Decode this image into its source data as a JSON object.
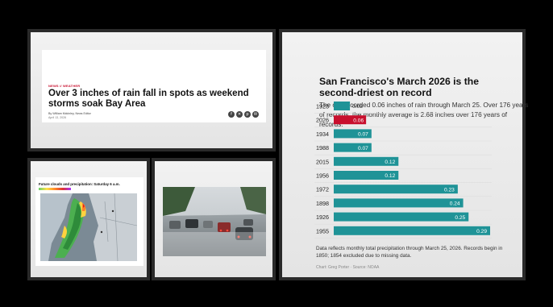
{
  "article": {
    "kicker": "NEWS // WEATHER",
    "headline": "Over 3 inches of rain fall in spots as weekend storms soak Bay Area",
    "byline": "By William Mckinley, News Editor",
    "date": "April 13, 2026",
    "share_icons": [
      "facebook-icon",
      "x-icon",
      "pinterest-icon",
      "email-icon"
    ]
  },
  "radar": {
    "title": "Future clouds and precipitation: Saturday 6 a.m."
  },
  "chart_data": {
    "type": "bar",
    "title": "San Francisco's March 2026 is the second-driest on record",
    "subtitle": "The city recorded 0.06 inches of rain through March 25. Over 176 years of records, the monthly average is 2.68 inches over 176 years of records.",
    "categories": [
      "1923",
      "2026",
      "1934",
      "1988",
      "2015",
      "1956",
      "1972",
      "1898",
      "1926",
      "1955"
    ],
    "values": [
      0.03,
      0.06,
      0.07,
      0.07,
      0.12,
      0.12,
      0.23,
      0.24,
      0.25,
      0.29
    ],
    "value_labels": [
      "0.03",
      "0.06",
      "0.07",
      "0.07",
      "0.12",
      "0.12",
      "0.23",
      "0.24",
      "0.25",
      "0.29"
    ],
    "highlight": "2026",
    "colors": {
      "bar": "#1f9397",
      "highlight": "#c8102e"
    },
    "xlim": [
      0,
      0.29
    ],
    "orientation": "horizontal",
    "grid": false,
    "note": "Data reflects monthly total precipitation through March 25, 2026. Records begin in 1850; 1854 excluded due to missing data.",
    "credit": "Chart: Greg Porter · Source: NOAA"
  }
}
